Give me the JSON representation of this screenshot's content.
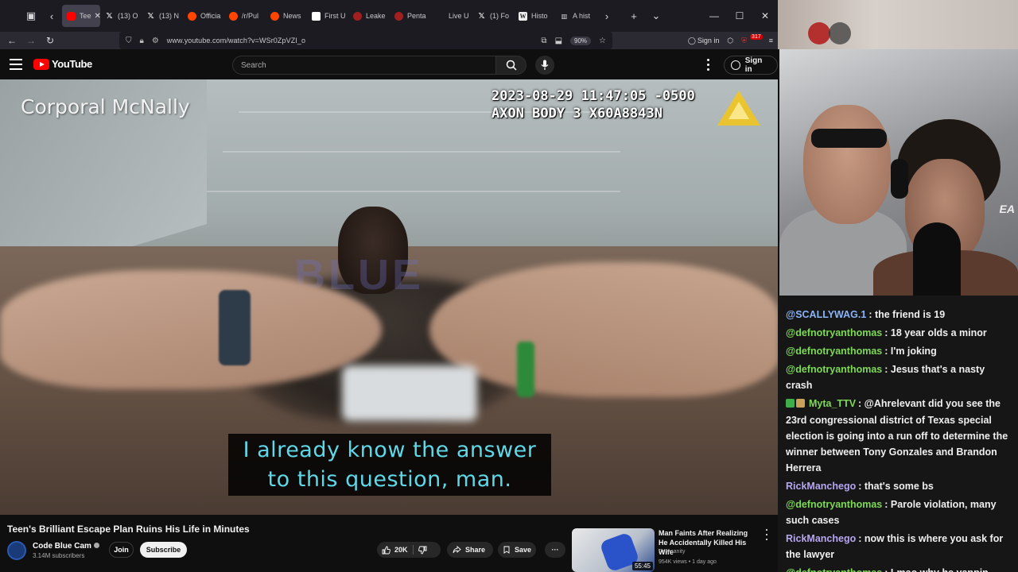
{
  "browser": {
    "tabs": [
      {
        "label": "Tee",
        "favicon": "youtube-icon",
        "active": true
      },
      {
        "label": "(13) O",
        "favicon": "x-icon"
      },
      {
        "label": "(13) N",
        "favicon": "x-icon"
      },
      {
        "label": "Officia",
        "favicon": "reddit-icon"
      },
      {
        "label": "/r/Pul",
        "favicon": "reddit-icon"
      },
      {
        "label": "News",
        "favicon": "reddit-icon"
      },
      {
        "label": "First U",
        "favicon": "news-icon"
      },
      {
        "label": "Leake",
        "favicon": "leak-icon"
      },
      {
        "label": "Penta",
        "favicon": "leak-icon"
      },
      {
        "label": "Live U",
        "favicon": "live-icon"
      },
      {
        "label": "(1) Fo",
        "favicon": "x-icon"
      },
      {
        "label": "Histo",
        "favicon": "wikipedia-icon"
      },
      {
        "label": "A hist",
        "favicon": "document-icon"
      }
    ],
    "url": "www.youtube.com/watch?v=WSr0ZpVZI_o",
    "zoom": "90%",
    "sign_in": "Sign in",
    "notif_count": "317"
  },
  "youtube": {
    "logo_text": "YouTube",
    "search_placeholder": "Search",
    "sign_in": "Sign in",
    "video": {
      "officer_label": "Corporal McNally",
      "timestamp": "2023-08-29 11:47:05 -0500",
      "device": "AXON BODY 3 X60A8843N",
      "watermark": "BLUE",
      "subtitle_line1": "I already know the answer",
      "subtitle_line2": "to this question, man."
    },
    "title": "Teen's Brilliant Escape Plan Ruins His Life in Minutes",
    "channel": {
      "name": "Code Blue Cam",
      "subscribers": "3.14M subscribers",
      "join": "Join",
      "subscribe": "Subscribe"
    },
    "actions": {
      "likes": "20K",
      "share": "Share",
      "save": "Save"
    },
    "recommended": {
      "title": "Man Faints After Realizing He Accidentally Killed His Wife",
      "channel": "Dr Insanity",
      "meta": "954K views • 1 day ago",
      "duration": "55:45"
    }
  },
  "overlay": {
    "cam_text": "EA"
  },
  "chat": {
    "messages": [
      {
        "user": "@SCALLYWAG.1",
        "user_color": "#8ab4f8",
        "text": ": the friend is 19",
        "badges": []
      },
      {
        "user": "@defnotryanthomas",
        "user_color": "#7ed957",
        "text": ": 18 year olds a minor",
        "badges": []
      },
      {
        "user": "@defnotryanthomas",
        "user_color": "#7ed957",
        "text": ": I'm joking",
        "badges": []
      },
      {
        "user": "@defnotryanthomas",
        "user_color": "#7ed957",
        "text": ": Jesus that's a nasty crash",
        "badges": []
      },
      {
        "user": "Myta_TTV",
        "user_color": "#7ed957",
        "text": ": @Ahrelevant did you see the 23rd congressional district of Texas special election is going into a run off to determine the winner between Tony Gonzales and Brandon Herrera",
        "badges": [
          "#3fae49",
          "#c9a25a"
        ]
      },
      {
        "user": "RickManchego",
        "user_color": "#b7a6f0",
        "text": ": that's some bs",
        "badges": []
      },
      {
        "user": "@defnotryanthomas",
        "user_color": "#7ed957",
        "text": ": Parole violation, many such cases",
        "badges": []
      },
      {
        "user": "RickManchego",
        "user_color": "#b7a6f0",
        "text": ": now this is where you ask for the lawyer",
        "badges": []
      },
      {
        "user": "@defnotryanthomas",
        "user_color": "#7ed957",
        "text": ": Lmao why he yappin",
        "badges": []
      }
    ]
  }
}
